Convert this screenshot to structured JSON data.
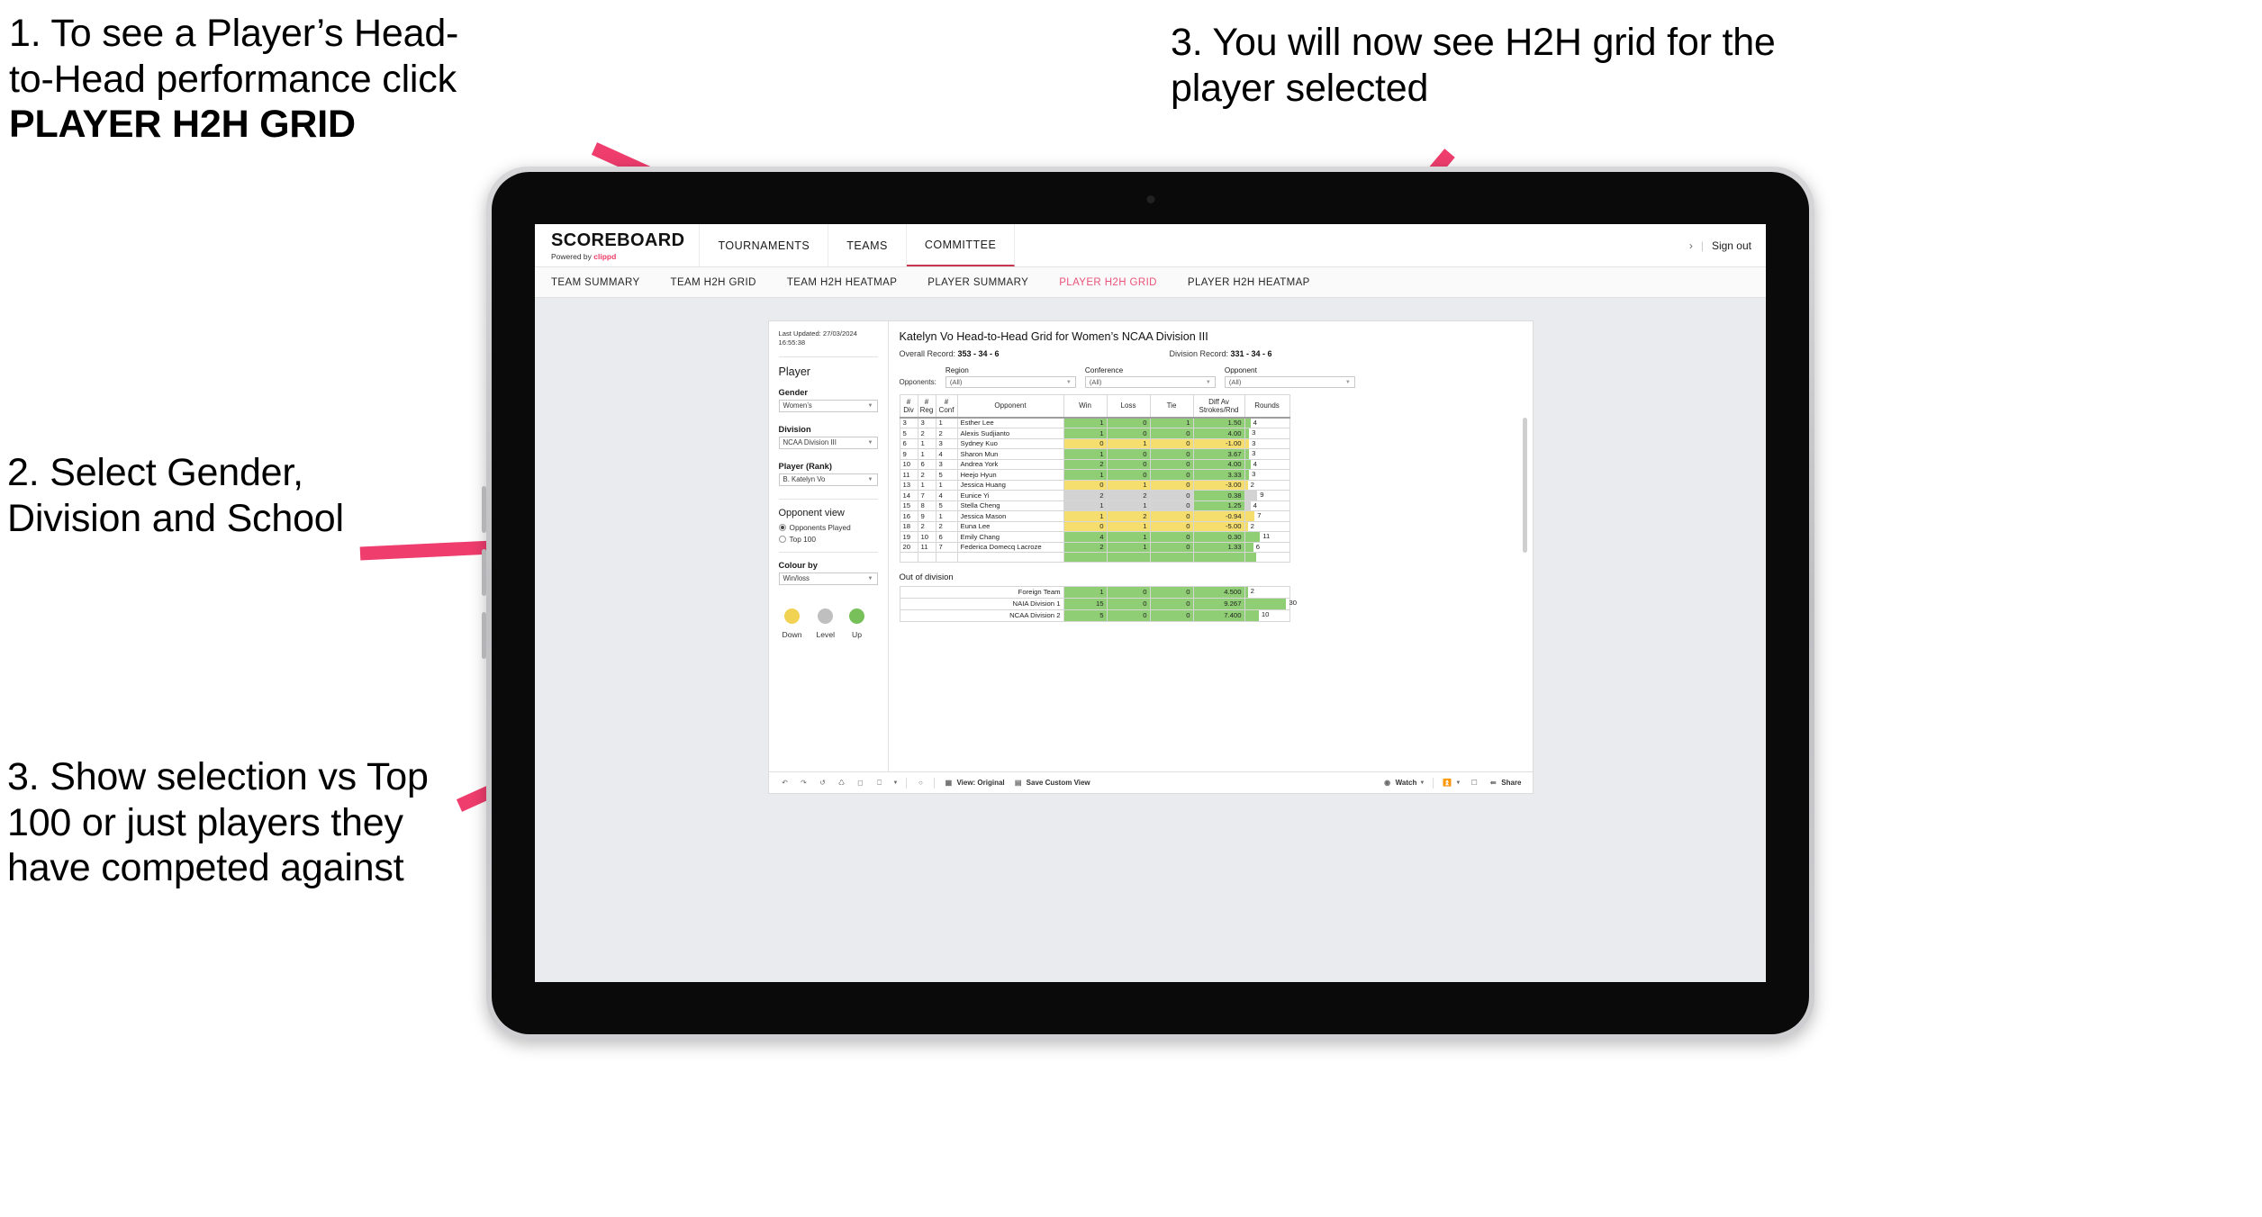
{
  "annotations": [
    {
      "id": "annot-1",
      "line1": "1. To see a Player’s Head-",
      "line2": "to-Head performance click",
      "line3": "PLAYER H2H GRID"
    },
    {
      "id": "annot-2",
      "text": "2. Select Gender, Division and School"
    },
    {
      "id": "annot-3",
      "text": "3. Show selection vs Top 100 or just players they have competed against"
    },
    {
      "id": "annot-4",
      "text": "3. You will now see H2H grid for the player selected"
    }
  ],
  "arrow_color": "#ef3d6e",
  "app": {
    "logo": {
      "main": "SCOREBOARD",
      "sub_prefix": "Powered by ",
      "sub_brand": "clippd"
    },
    "topnav": [
      {
        "label": "TOURNAMENTS",
        "active": false
      },
      {
        "label": "TEAMS",
        "active": false
      },
      {
        "label": "COMMITTEE",
        "active": true
      }
    ],
    "topnav_right": {
      "chevron": "›",
      "divider": "|",
      "sign_out": "Sign out"
    },
    "subnav": [
      {
        "label": "TEAM SUMMARY",
        "active": false
      },
      {
        "label": "TEAM H2H GRID",
        "active": false
      },
      {
        "label": "TEAM H2H HEATMAP",
        "active": false
      },
      {
        "label": "PLAYER SUMMARY",
        "active": false
      },
      {
        "label": "PLAYER H2H GRID",
        "active": true
      },
      {
        "label": "PLAYER H2H HEATMAP",
        "active": false
      }
    ]
  },
  "filters": {
    "last_updated_line1": "Last Updated: 27/03/2024",
    "last_updated_line2": "16:55:38",
    "section_title": "Player",
    "fields": [
      {
        "label": "Gender",
        "value": "Women’s"
      },
      {
        "label": "Division",
        "value": "NCAA Division III"
      },
      {
        "label": "Player (Rank)",
        "value": "B. Katelyn Vo"
      }
    ],
    "opponent_view": {
      "title": "Opponent view",
      "options": [
        {
          "label": "Opponents Played",
          "selected": true
        },
        {
          "label": "Top 100",
          "selected": false
        }
      ]
    },
    "colour_by": {
      "label": "Colour by",
      "value": "Win/loss"
    },
    "legend": [
      {
        "label": "Down",
        "color": "#f1d252"
      },
      {
        "label": "Level",
        "color": "#bfbfbf"
      },
      {
        "label": "Up",
        "color": "#77c05a"
      }
    ]
  },
  "viz": {
    "title": "Katelyn Vo Head-to-Head Grid for Women’s NCAA Division III",
    "overall_label": "Overall Record: ",
    "overall_value": "353 - 34 - 6",
    "division_label": "Division Record: ",
    "division_value": "331 - 34 - 6",
    "opponents_label": "Opponents:",
    "opponent_filters": [
      {
        "caption": "Region",
        "value": "(All)"
      },
      {
        "caption": "Conference",
        "value": "(All)"
      },
      {
        "caption": "Opponent",
        "value": "(All)"
      }
    ],
    "columns": [
      {
        "l1": "#",
        "l2": "Div"
      },
      {
        "l1": "#",
        "l2": "Reg"
      },
      {
        "l1": "#",
        "l2": "Conf"
      },
      {
        "l1": "",
        "l2": "Opponent"
      },
      {
        "l1": "",
        "l2": "Win"
      },
      {
        "l1": "",
        "l2": "Loss"
      },
      {
        "l1": "",
        "l2": "Tie"
      },
      {
        "l1": "Diff Av",
        "l2": "Strokes/Rnd"
      },
      {
        "l1": "",
        "l2": "Rounds"
      }
    ],
    "out_of_division_title": "Out of division"
  },
  "chart_data": {
    "type": "table",
    "title": "Katelyn Vo Head-to-Head Grid for Women’s NCAA Division III",
    "columns": [
      "# Div",
      "# Reg",
      "# Conf",
      "Opponent",
      "Win",
      "Loss",
      "Tie",
      "Diff Av Strokes/Rnd",
      "Rounds"
    ],
    "colors": {
      "up": "#8fce75",
      "down": "#f5dd6e",
      "level": "#d3d3d3",
      "none": "#ffffff"
    },
    "rounds_max": 32,
    "rows": [
      {
        "div": "3",
        "reg": "3",
        "conf": "1",
        "opponent": "Esther Lee",
        "win": "1",
        "loss": "0",
        "tie": "1",
        "diff": "1.50",
        "rounds": "4",
        "state": "up"
      },
      {
        "div": "5",
        "reg": "2",
        "conf": "2",
        "opponent": "Alexis Sudjianto",
        "win": "1",
        "loss": "0",
        "tie": "0",
        "diff": "4.00",
        "rounds": "3",
        "state": "up"
      },
      {
        "div": "6",
        "reg": "1",
        "conf": "3",
        "opponent": "Sydney Kuo",
        "win": "0",
        "loss": "1",
        "tie": "0",
        "diff": "-1.00",
        "rounds": "3",
        "state": "down"
      },
      {
        "div": "9",
        "reg": "1",
        "conf": "4",
        "opponent": "Sharon Mun",
        "win": "1",
        "loss": "0",
        "tie": "0",
        "diff": "3.67",
        "rounds": "3",
        "state": "up"
      },
      {
        "div": "10",
        "reg": "6",
        "conf": "3",
        "opponent": "Andrea York",
        "win": "2",
        "loss": "0",
        "tie": "0",
        "diff": "4.00",
        "rounds": "4",
        "state": "up"
      },
      {
        "div": "11",
        "reg": "2",
        "conf": "5",
        "opponent": "Heejo Hyun",
        "win": "1",
        "loss": "0",
        "tie": "0",
        "diff": "3.33",
        "rounds": "3",
        "state": "up"
      },
      {
        "div": "13",
        "reg": "1",
        "conf": "1",
        "opponent": "Jessica Huang",
        "win": "0",
        "loss": "1",
        "tie": "0",
        "diff": "-3.00",
        "rounds": "2",
        "state": "down"
      },
      {
        "div": "14",
        "reg": "7",
        "conf": "4",
        "opponent": "Eunice Yi",
        "win": "2",
        "loss": "2",
        "tie": "0",
        "diff": "0.38",
        "rounds": "9",
        "state": "level",
        "diff_state": "up"
      },
      {
        "div": "15",
        "reg": "8",
        "conf": "5",
        "opponent": "Stella Cheng",
        "win": "1",
        "loss": "1",
        "tie": "0",
        "diff": "1.25",
        "rounds": "4",
        "state": "level",
        "diff_state": "up"
      },
      {
        "div": "16",
        "reg": "9",
        "conf": "1",
        "opponent": "Jessica Mason",
        "win": "1",
        "loss": "2",
        "tie": "0",
        "diff": "-0.94",
        "rounds": "7",
        "state": "down"
      },
      {
        "div": "18",
        "reg": "2",
        "conf": "2",
        "opponent": "Euna Lee",
        "win": "0",
        "loss": "1",
        "tie": "0",
        "diff": "-5.00",
        "rounds": "2",
        "state": "down"
      },
      {
        "div": "19",
        "reg": "10",
        "conf": "6",
        "opponent": "Emily Chang",
        "win": "4",
        "loss": "1",
        "tie": "0",
        "diff": "0.30",
        "rounds": "11",
        "state": "up"
      },
      {
        "div": "20",
        "reg": "11",
        "conf": "7",
        "opponent": "Federica Domecq Lacroze",
        "win": "2",
        "loss": "1",
        "tie": "0",
        "diff": "1.33",
        "rounds": "6",
        "state": "up"
      }
    ],
    "out_of_division": [
      {
        "name": "Foreign Team",
        "win": "1",
        "loss": "0",
        "tie": "0",
        "diff": "4.500",
        "rounds": "2",
        "state": "up"
      },
      {
        "name": "NAIA Division 1",
        "win": "15",
        "loss": "0",
        "tie": "0",
        "diff": "9.267",
        "rounds": "30",
        "state": "up"
      },
      {
        "name": "NCAA Division 2",
        "win": "5",
        "loss": "0",
        "tie": "0",
        "diff": "7.400",
        "rounds": "10",
        "state": "up"
      }
    ]
  },
  "toolbar": {
    "icons": [
      "undo-icon",
      "redo-icon",
      "revert-icon",
      "refresh-icon",
      "pause-icon",
      "clear-sheet-icon"
    ],
    "view_label": "View: Original",
    "save_label": "Save Custom View",
    "watch_label": "Watch",
    "share_label": "Share"
  }
}
